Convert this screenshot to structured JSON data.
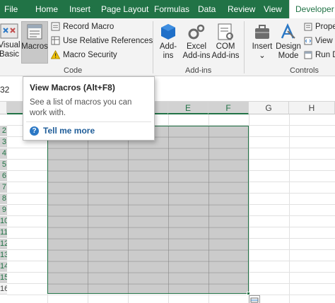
{
  "tabs": [
    {
      "label": "File"
    },
    {
      "label": "Home"
    },
    {
      "label": "Insert"
    },
    {
      "label": "Page Layout"
    },
    {
      "label": "Formulas"
    },
    {
      "label": "Data"
    },
    {
      "label": "Review"
    },
    {
      "label": "View"
    },
    {
      "label": "Developer"
    }
  ],
  "ribbon": {
    "code": {
      "visual_basic_line1": "Visual",
      "visual_basic_line2": "Basic",
      "macros": "Macros",
      "record_macro": "Record Macro",
      "use_relative": "Use Relative References",
      "macro_security": "Macro Security",
      "group_label": "Code"
    },
    "addins": {
      "addins_line1": "Add-",
      "addins_line2": "ins",
      "excel_addins_line1": "Excel",
      "excel_addins_line2": "Add-ins",
      "com_addins_line1": "COM",
      "com_addins_line2": "Add-ins",
      "group_label": "Add-ins"
    },
    "controls": {
      "insert": "Insert",
      "insert_arrow": "⌄",
      "design_mode_line1": "Design",
      "design_mode_line2": "Mode",
      "properties": "Prope",
      "view_code": "View C",
      "run_dialog": "Run D",
      "group_label": "Controls"
    }
  },
  "namebox": "32",
  "columns": [
    "E",
    "F",
    "G",
    "H"
  ],
  "rows": [
    "2",
    "3",
    "4",
    "5",
    "6",
    "7",
    "8",
    "9",
    "10",
    "11",
    "12",
    "13",
    "14",
    "15",
    "16"
  ],
  "tooltip": {
    "title": "View Macros (Alt+F8)",
    "description": "See a list of macros you can work with.",
    "help_icon": "?",
    "help": "Tell me more"
  },
  "colors": {
    "accent": "#217346",
    "selection": "#a0a0a0",
    "link": "#1f5d99"
  },
  "icons": [
    "visual-basic-icon",
    "macros-icon",
    "record-macro-icon",
    "relative-references-icon",
    "warning-icon",
    "addins-icon",
    "excel-addins-icon",
    "com-addins-icon",
    "insert-controls-icon",
    "design-mode-icon",
    "properties-icon",
    "view-code-icon",
    "run-dialog-icon",
    "help-icon",
    "quick-analysis-icon"
  ]
}
